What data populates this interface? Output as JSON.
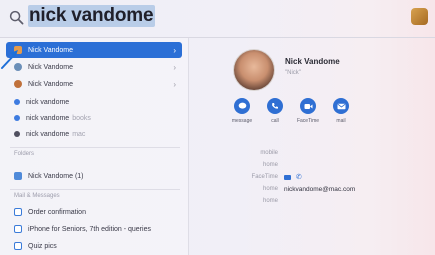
{
  "search": {
    "query": "nick vandome"
  },
  "results": {
    "top_hits": [
      {
        "label": "Nick Vandome",
        "suffix": "",
        "icon": "contact-card-icon",
        "color": "#c77a33",
        "selected": true
      },
      {
        "label": "Nick Vandome",
        "suffix": "",
        "icon": "safari-icon",
        "color": "#6b8fb8",
        "selected": false
      },
      {
        "label": "Nick Vandome",
        "suffix": "",
        "icon": "contact-photo-icon",
        "color": "#c0713b",
        "selected": false
      },
      {
        "label": "nick vandome",
        "suffix": "",
        "icon": "search-suggestion-icon",
        "color": "#3d7be0",
        "selected": false
      },
      {
        "label": "nick vandome",
        "suffix": "books",
        "icon": "search-suggestion-icon",
        "color": "#3d7be0",
        "selected": false
      },
      {
        "label": "nick vandome",
        "suffix": "mac",
        "icon": "search-suggestion-icon",
        "color": "#505060",
        "selected": false
      }
    ],
    "folders_header": "Folders",
    "folders": [
      {
        "label": "Nick Vandome (1)",
        "icon": "folder-icon",
        "color": "#4f8ad9"
      }
    ],
    "mail_header": "Mail & Messages",
    "mail": [
      {
        "label": "Order confirmation",
        "icon": "mail-icon",
        "color": "#3a7bd9"
      },
      {
        "label": "iPhone for Seniors, 7th edition - queries",
        "icon": "mail-icon",
        "color": "#3a7bd9"
      },
      {
        "label": "Quiz pics",
        "icon": "mail-icon",
        "color": "#3a7bd9"
      }
    ]
  },
  "contact": {
    "name": "Nick Vandome",
    "subtitle": "\"Nick\"",
    "actions": [
      {
        "label": "message",
        "icon": "message-icon"
      },
      {
        "label": "call",
        "icon": "phone-icon"
      },
      {
        "label": "FaceTime",
        "icon": "video-icon"
      },
      {
        "label": "mail",
        "icon": "mail-icon"
      }
    ],
    "fields": [
      {
        "label": "mobile",
        "value": ""
      },
      {
        "label": "home",
        "value": ""
      },
      {
        "label": "FaceTime",
        "value": ""
      },
      {
        "label": "home",
        "value": "nickvandome@mac.com"
      },
      {
        "label": "home",
        "value": ""
      }
    ]
  },
  "colors": {
    "accent": "#2b6fd6",
    "selection": "#b9cde8"
  }
}
